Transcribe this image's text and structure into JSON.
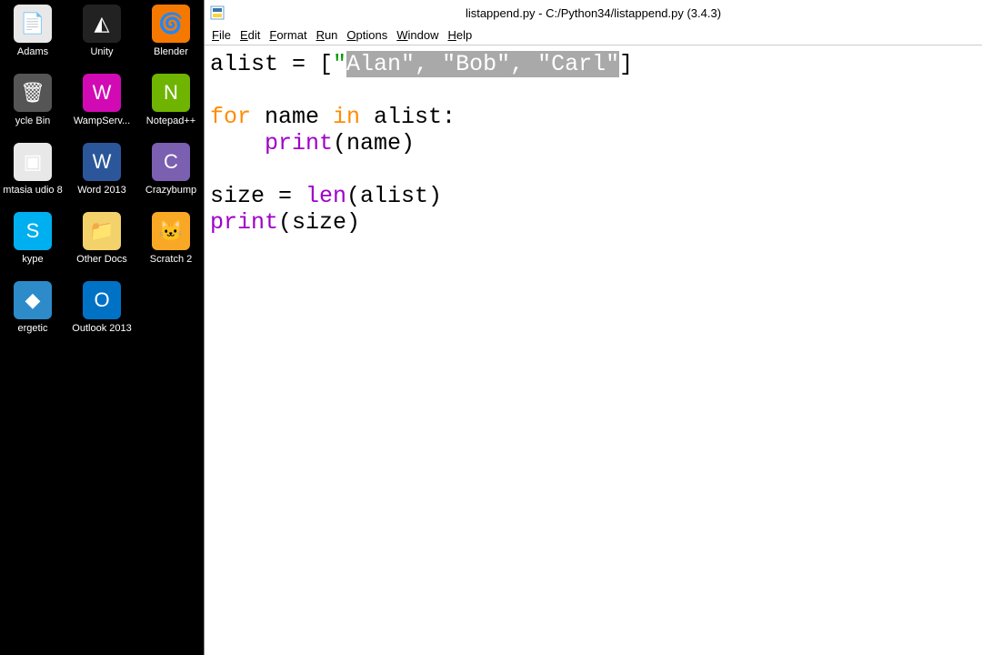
{
  "desktop": {
    "rows": [
      [
        {
          "label": "Adams",
          "bg": "#e8e8e8",
          "glyph": "📄"
        },
        {
          "label": "Unity",
          "bg": "#222",
          "glyph": "◭"
        },
        {
          "label": "Blender",
          "bg": "#f57900",
          "glyph": "🌀"
        }
      ],
      [
        {
          "label": "ycle Bin",
          "bg": "#555",
          "glyph": "🗑"
        },
        {
          "label": "WampServ...",
          "bg": "#d10ab4",
          "glyph": "W"
        },
        {
          "label": "Notepad++",
          "bg": "#6fb400",
          "glyph": "N"
        }
      ],
      [
        {
          "label": "mtasia udio 8",
          "bg": "#e8e8e8",
          "glyph": "▣"
        },
        {
          "label": "Word 2013",
          "bg": "#2b579a",
          "glyph": "W"
        },
        {
          "label": "Crazybump",
          "bg": "#7b5fb0",
          "glyph": "C"
        }
      ],
      [
        {
          "label": "kype",
          "bg": "#00aff0",
          "glyph": "S"
        },
        {
          "label": "Other Docs",
          "bg": "#f3d16b",
          "glyph": "📁"
        },
        {
          "label": "Scratch 2",
          "bg": "#f9a825",
          "glyph": "🐱"
        }
      ],
      [
        {
          "label": "ergetic",
          "bg": "#2e8bca",
          "glyph": "◆"
        },
        {
          "label": "Outlook 2013",
          "bg": "#0072c6",
          "glyph": "O"
        }
      ]
    ]
  },
  "window": {
    "title": "listappend.py - C:/Python34/listappend.py (3.4.3)",
    "menus": [
      "File",
      "Edit",
      "Format",
      "Run",
      "Options",
      "Window",
      "Help"
    ]
  },
  "code": {
    "line1_a": "alist = [",
    "line1_q1": "\"",
    "line1_sel": "Alan\", \"Bob\", \"Carl\"",
    "line1_end": "]",
    "line2": "",
    "line3_for": "for",
    "line3_mid": " name ",
    "line3_in": "in",
    "line3_end": " alist:",
    "line4_pad": "    ",
    "line4_fn": "print",
    "line4_arg": "(name)",
    "line5": "",
    "line6_a": "size = ",
    "line6_fn": "len",
    "line6_b": "(alist)",
    "line7_fn": "print",
    "line7_arg": "(size)"
  }
}
